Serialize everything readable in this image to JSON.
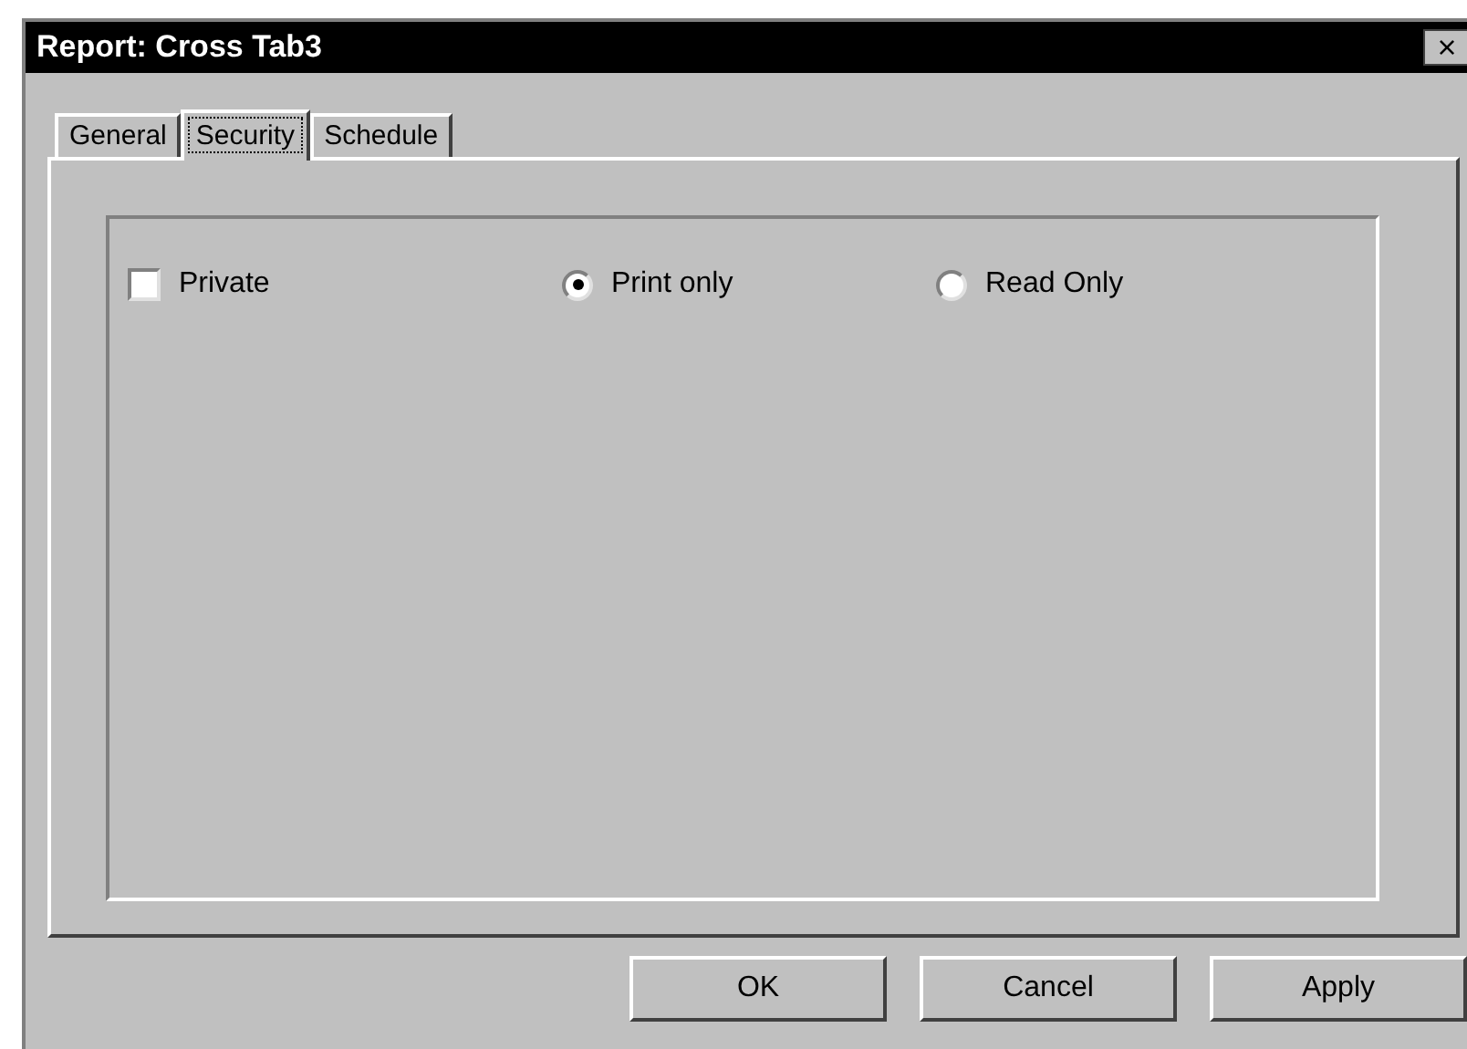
{
  "window": {
    "title": "Report: Cross Tab3",
    "close": "×"
  },
  "tabs": [
    {
      "label": "General",
      "selected": false
    },
    {
      "label": "Security",
      "selected": true
    },
    {
      "label": "Schedule",
      "selected": false
    }
  ],
  "options": [
    {
      "kind": "checkbox",
      "label": "Private",
      "checked": false
    },
    {
      "kind": "radio",
      "label": "Print only",
      "selected": true
    },
    {
      "kind": "radio",
      "label": "Read Only",
      "selected": false
    }
  ],
  "buttons": [
    "OK",
    "Cancel",
    "Apply"
  ]
}
